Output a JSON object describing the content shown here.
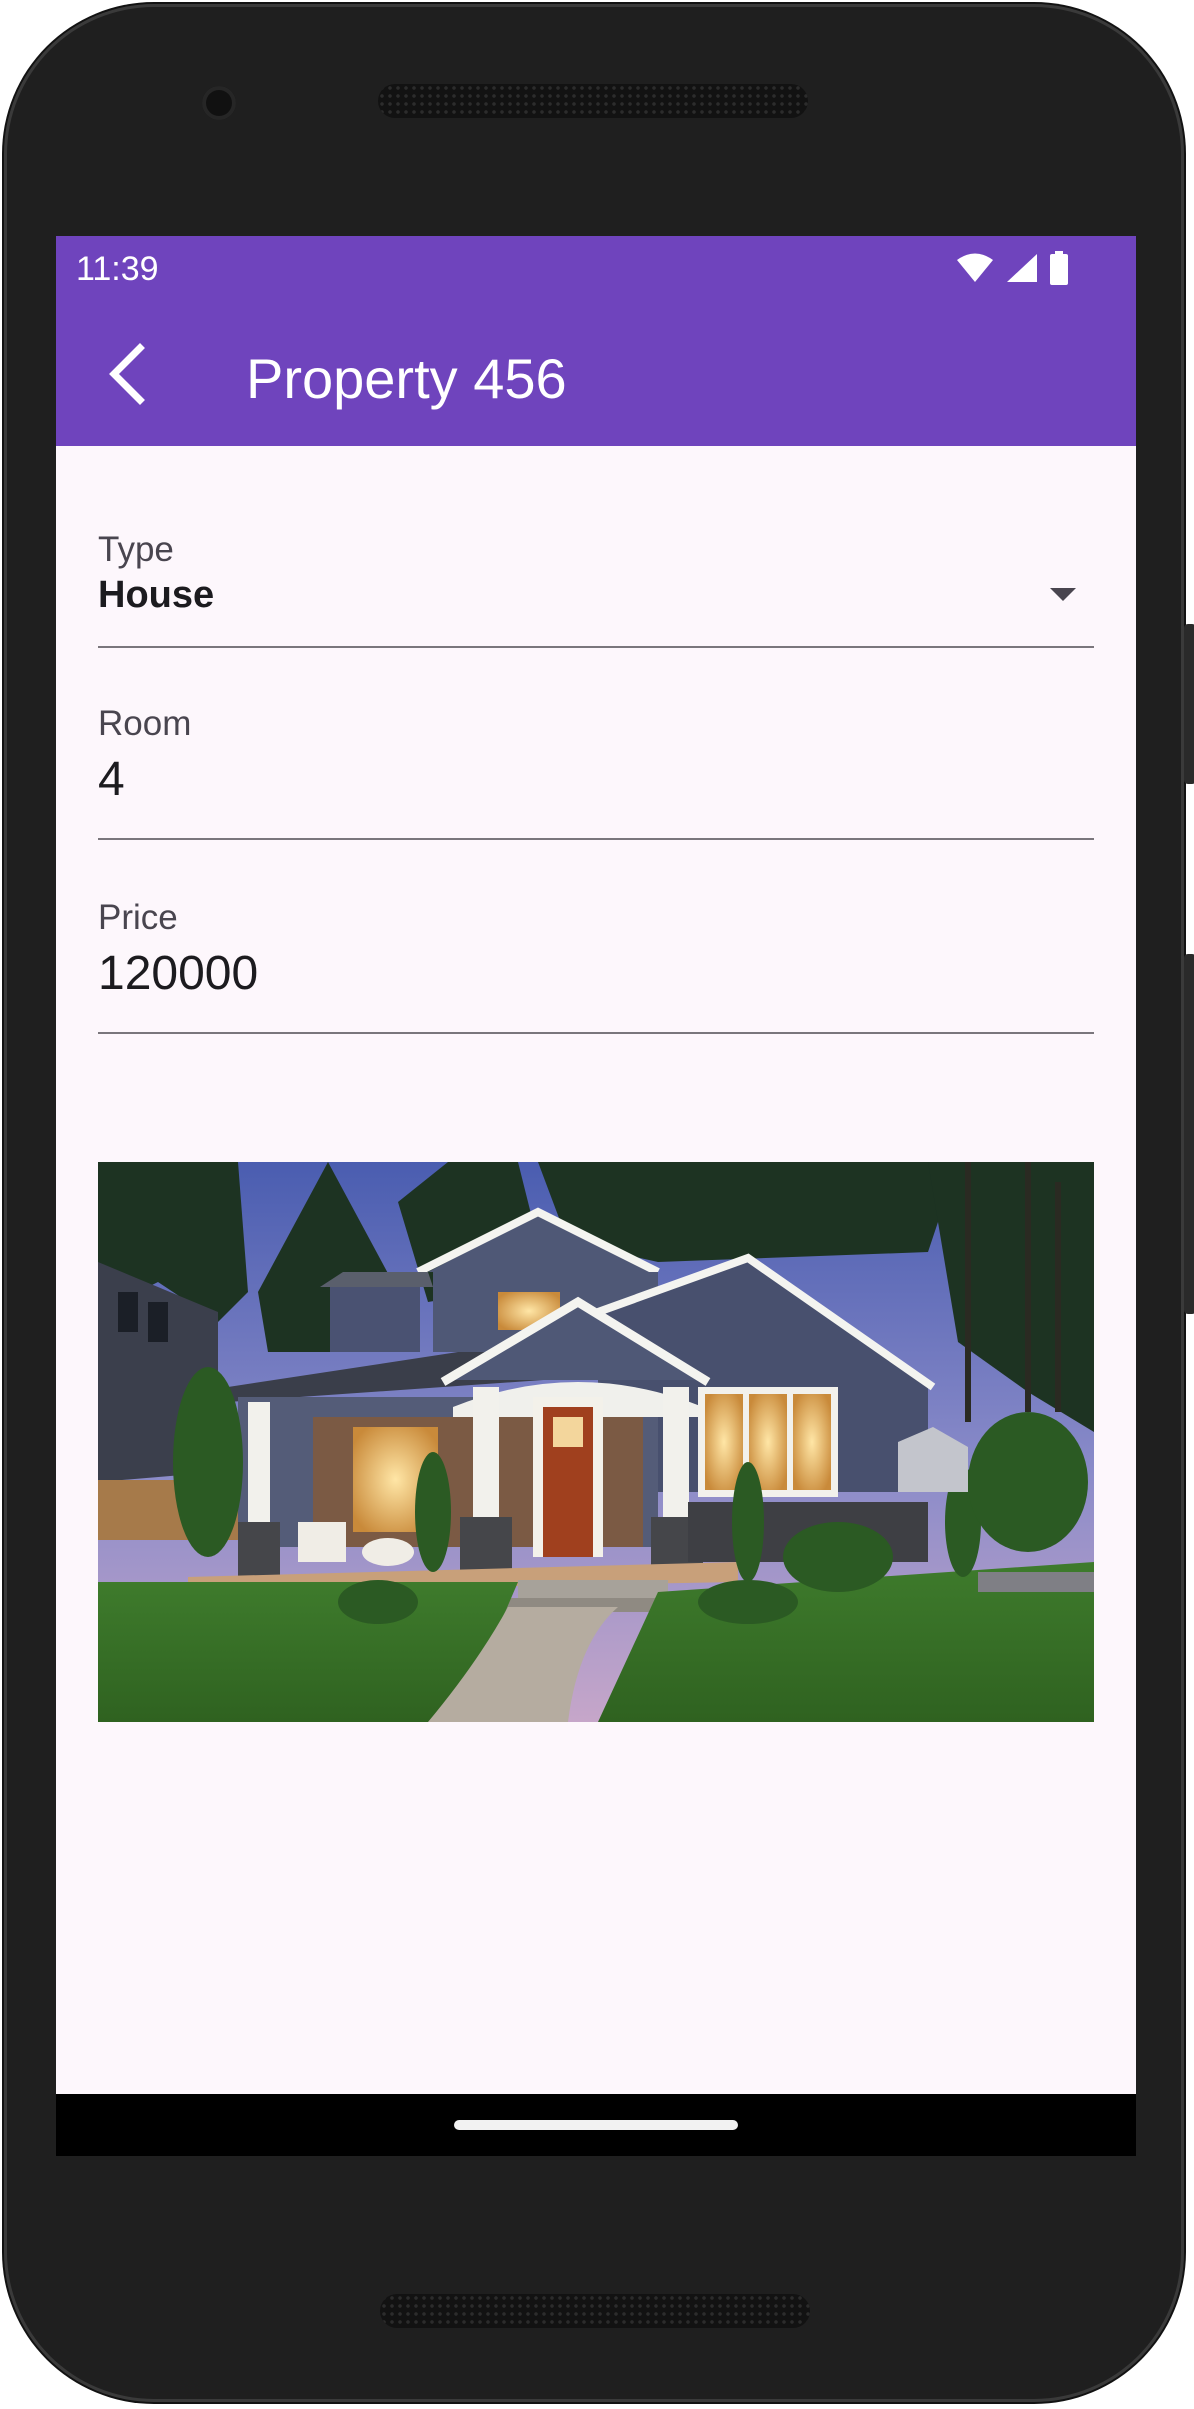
{
  "status_bar": {
    "time": "11:39",
    "icons": [
      "wifi-icon",
      "cellular-signal-icon",
      "battery-icon"
    ]
  },
  "app_bar": {
    "title": "Property 456",
    "back_icon": "chevron-left-icon",
    "color": "#6f44bd"
  },
  "form": {
    "type": {
      "label": "Type",
      "value": "House",
      "icon": "dropdown-arrow-icon"
    },
    "room": {
      "label": "Room",
      "value": "4"
    },
    "price": {
      "label": "Price",
      "value": "120000"
    }
  },
  "property_image": {
    "alt": "House exterior at dusk"
  },
  "colors": {
    "accent": "#6f44bd",
    "background": "#fdf7fc",
    "text": "#1c1b1f",
    "label": "#49454f"
  }
}
